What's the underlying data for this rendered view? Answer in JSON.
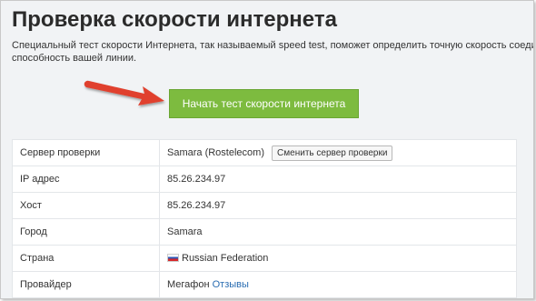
{
  "page": {
    "title": "Проверка скорости интернета",
    "description_line1": "Специальный тест скорости Интернета, так называемый speed test, поможет определить точную скорость соединения.",
    "description_line2": "способность вашей линии."
  },
  "actions": {
    "start_label": "Начать тест скорости интернета",
    "change_server_label": "Сменить сервер проверки"
  },
  "info": {
    "server_label": "Сервер проверки",
    "server_value": "Samara (Rostelecom)",
    "ip_label": "IP адрес",
    "ip_value": "85.26.234.97",
    "host_label": "Хост",
    "host_value": "85.26.234.97",
    "city_label": "Город",
    "city_value": "Samara",
    "country_label": "Страна",
    "country_value": "Russian Federation",
    "provider_label": "Провайдер",
    "provider_value": "Мегафон",
    "reviews_link": "Отзывы"
  },
  "icons": {
    "arrow": "red-pointer-arrow-icon",
    "flag": "russia-flag-icon"
  },
  "colors": {
    "start_button": "#7dbb3f",
    "arrow": "#e0402e",
    "link": "#2a6db2"
  }
}
